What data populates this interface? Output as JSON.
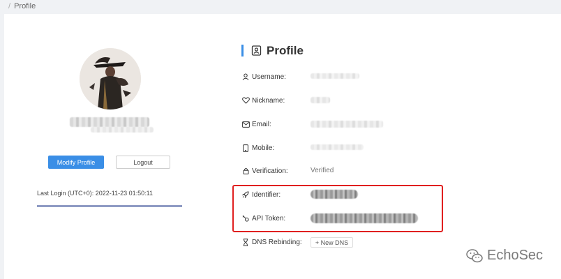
{
  "breadcrumb": {
    "separator": "/",
    "current": "Profile"
  },
  "left_panel": {
    "modify_label": "Modify Profile",
    "logout_label": "Logout",
    "last_login": "Last Login (UTC+0): 2022-11-23 01:50:11",
    "progress": 1.0
  },
  "profile": {
    "title": "Profile",
    "fields": {
      "username": {
        "label": "Username:"
      },
      "nickname": {
        "label": "Nickname:"
      },
      "email": {
        "label": "Email:"
      },
      "mobile": {
        "label": "Mobile:"
      },
      "verification": {
        "label": "Verification:",
        "value": "Verified"
      },
      "identifier": {
        "label": "Identifier:"
      },
      "api_token": {
        "label": "API Token:"
      },
      "dns_rebinding": {
        "label": "DNS Rebinding:",
        "button": "+ New DNS"
      }
    }
  },
  "watermark": {
    "text": "EchoSec"
  },
  "colors": {
    "accent": "#3a8ee6",
    "highlight": "#e02020"
  }
}
